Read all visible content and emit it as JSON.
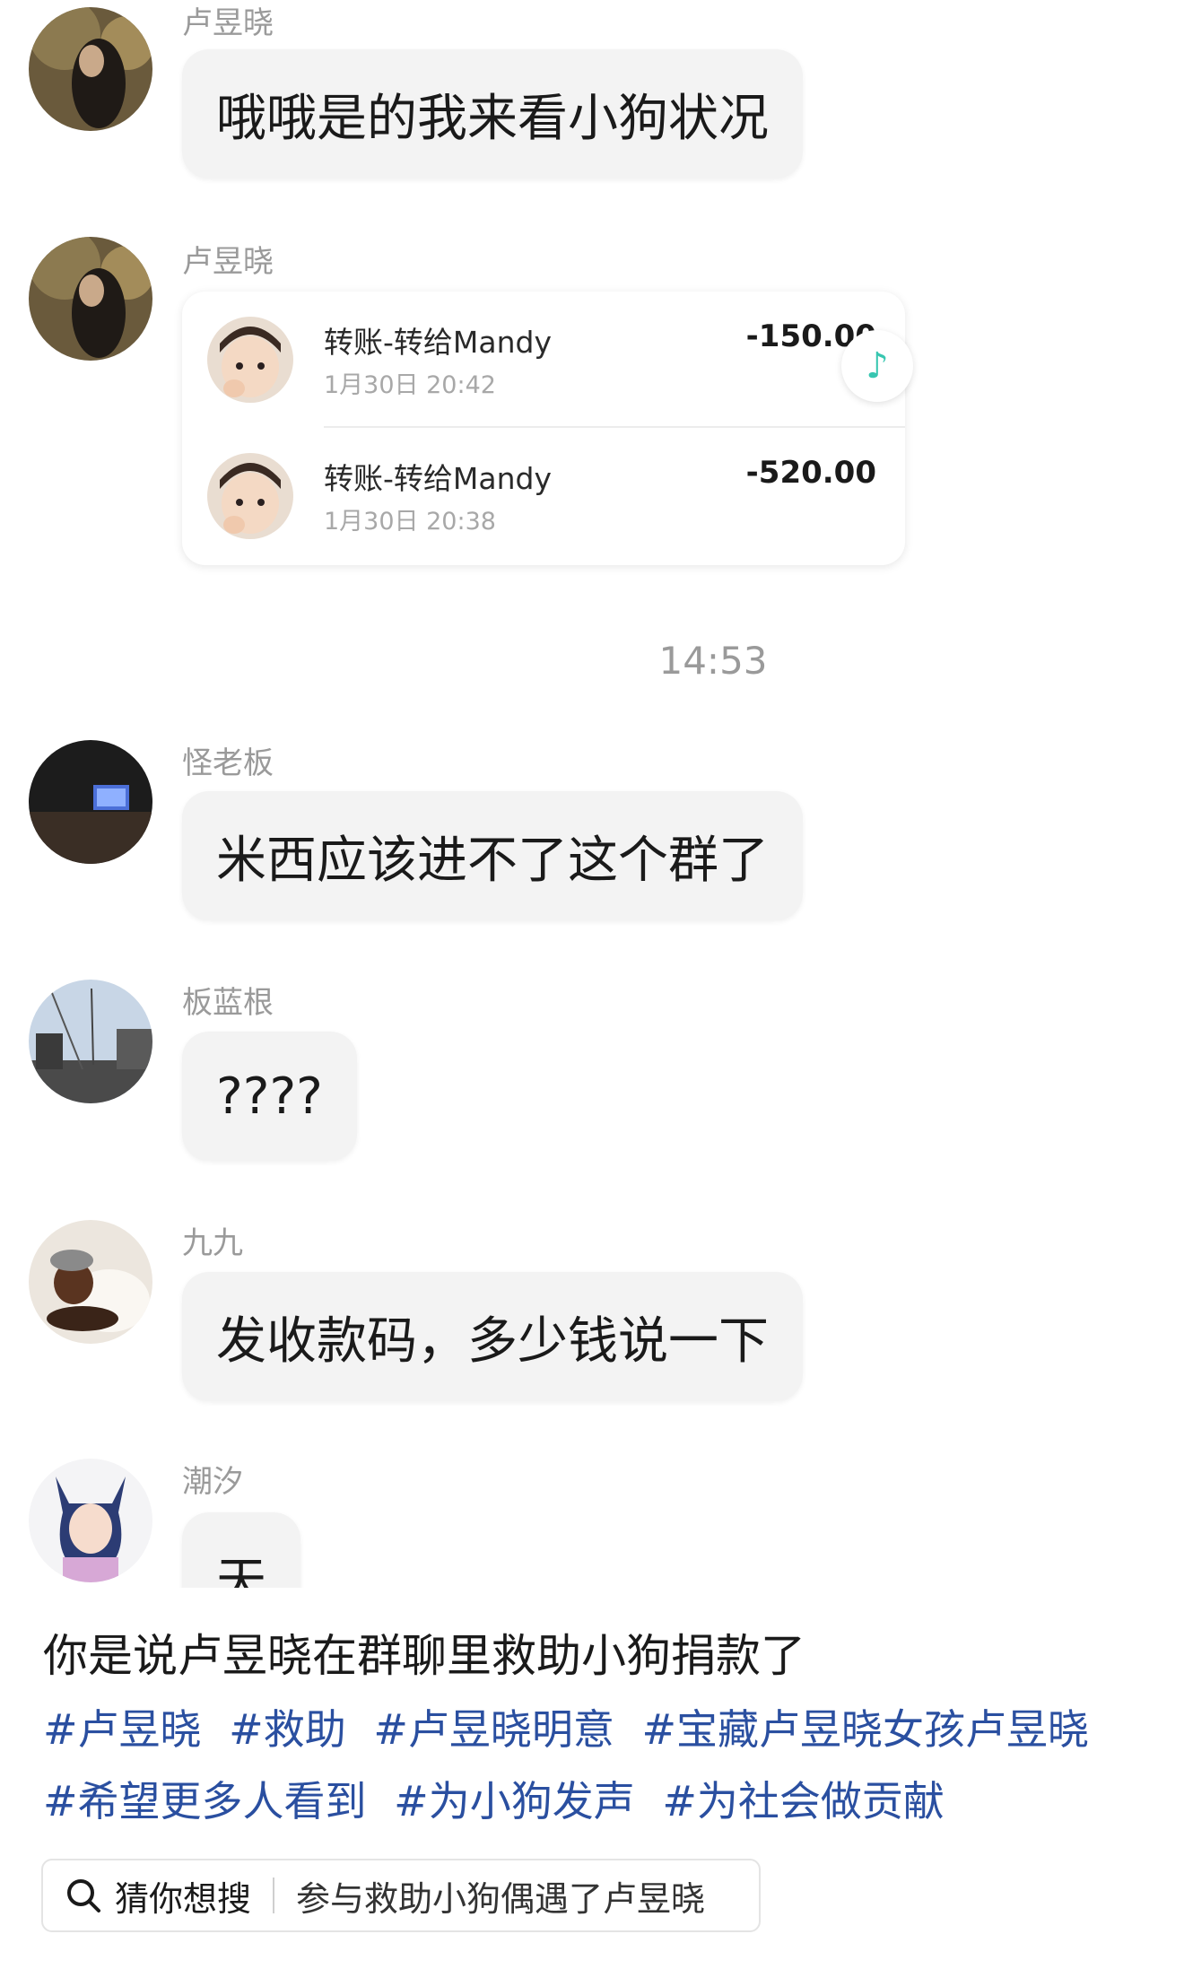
{
  "messages": [
    {
      "sender": "卢昱晓",
      "text": "哦哦是的我来看小狗状况"
    },
    {
      "sender": "卢昱晓"
    },
    {
      "sender": "怪老板",
      "text": "米西应该进不了这个群了"
    },
    {
      "sender": "板蓝根",
      "text": "????"
    },
    {
      "sender": "九九",
      "text": "发收款码，多少钱说一下"
    },
    {
      "sender": "潮汐",
      "text": "天"
    }
  ],
  "transfers": [
    {
      "title": "转账-转给Mandy",
      "date": "1月30日 20:42",
      "amount": "-150.00"
    },
    {
      "title": "转账-转给Mandy",
      "date": "1月30日 20:38",
      "amount": "-520.00"
    }
  ],
  "timestamp": "14:53",
  "post": {
    "title": "你是说卢昱晓在群聊里救助小狗捐款了",
    "tags": [
      "#卢昱晓",
      "#救助",
      "#卢昱晓明意",
      "#宝藏卢昱晓女孩卢昱晓",
      "#希望更多人看到",
      "#为小狗发声",
      "#为社会做贡献"
    ]
  },
  "search": {
    "label": "猜你想搜",
    "query": "参与救助小狗偶遇了卢昱晓"
  },
  "icons": {
    "music": "music-note-icon",
    "search": "search-icon"
  }
}
